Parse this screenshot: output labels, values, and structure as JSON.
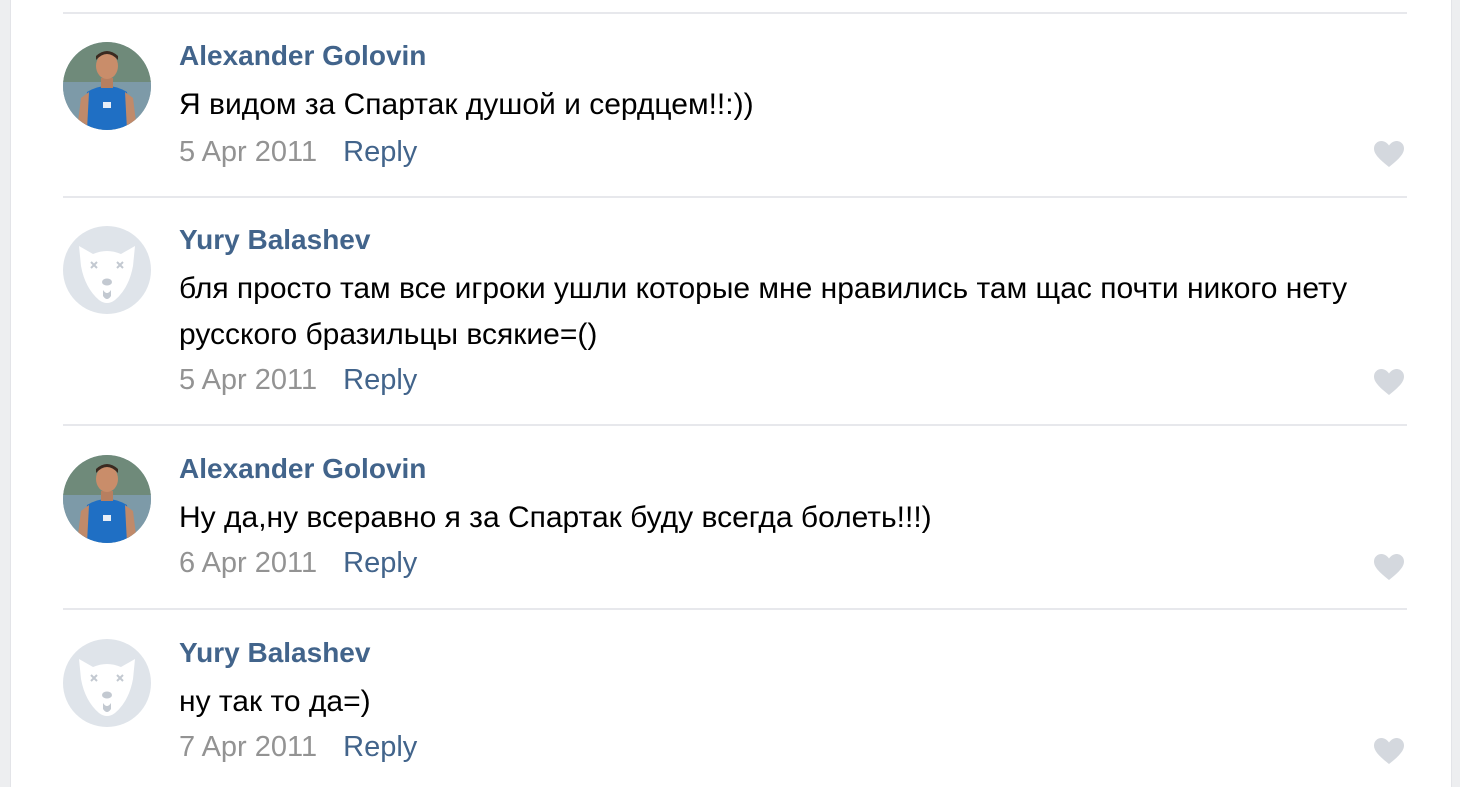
{
  "comments": [
    {
      "author": "Alexander Golovin",
      "text": "Я видом за Спартак душой и сердцем!!:))",
      "date": "5 Apr 2011",
      "reply_label": "Reply",
      "avatar": "user-photo-avatar"
    },
    {
      "author": "Yury Balashev",
      "text": "бля просто там все игроки ушли которые мне нравились там щас почти никого нету русского бразильцы всякие=()",
      "date": "5 Apr 2011",
      "reply_label": "Reply",
      "avatar": "deleted-dog-avatar"
    },
    {
      "author": "Alexander Golovin",
      "text": "Ну да,ну всеравно я за Спартак буду всегда болеть!!!)",
      "date": "6 Apr 2011",
      "reply_label": "Reply",
      "avatar": "user-photo-avatar"
    },
    {
      "author": "Yury Balashev",
      "text": "ну так то да=)",
      "date": "7 Apr 2011",
      "reply_label": "Reply",
      "avatar": "deleted-dog-avatar"
    }
  ],
  "icons": {
    "like": "heart-icon"
  },
  "colors": {
    "link": "#42648b",
    "date": "#939393",
    "divider": "#e7e8ec",
    "heart": "#d4d8de",
    "dog_avatar_bg": "#dfe4ea"
  }
}
